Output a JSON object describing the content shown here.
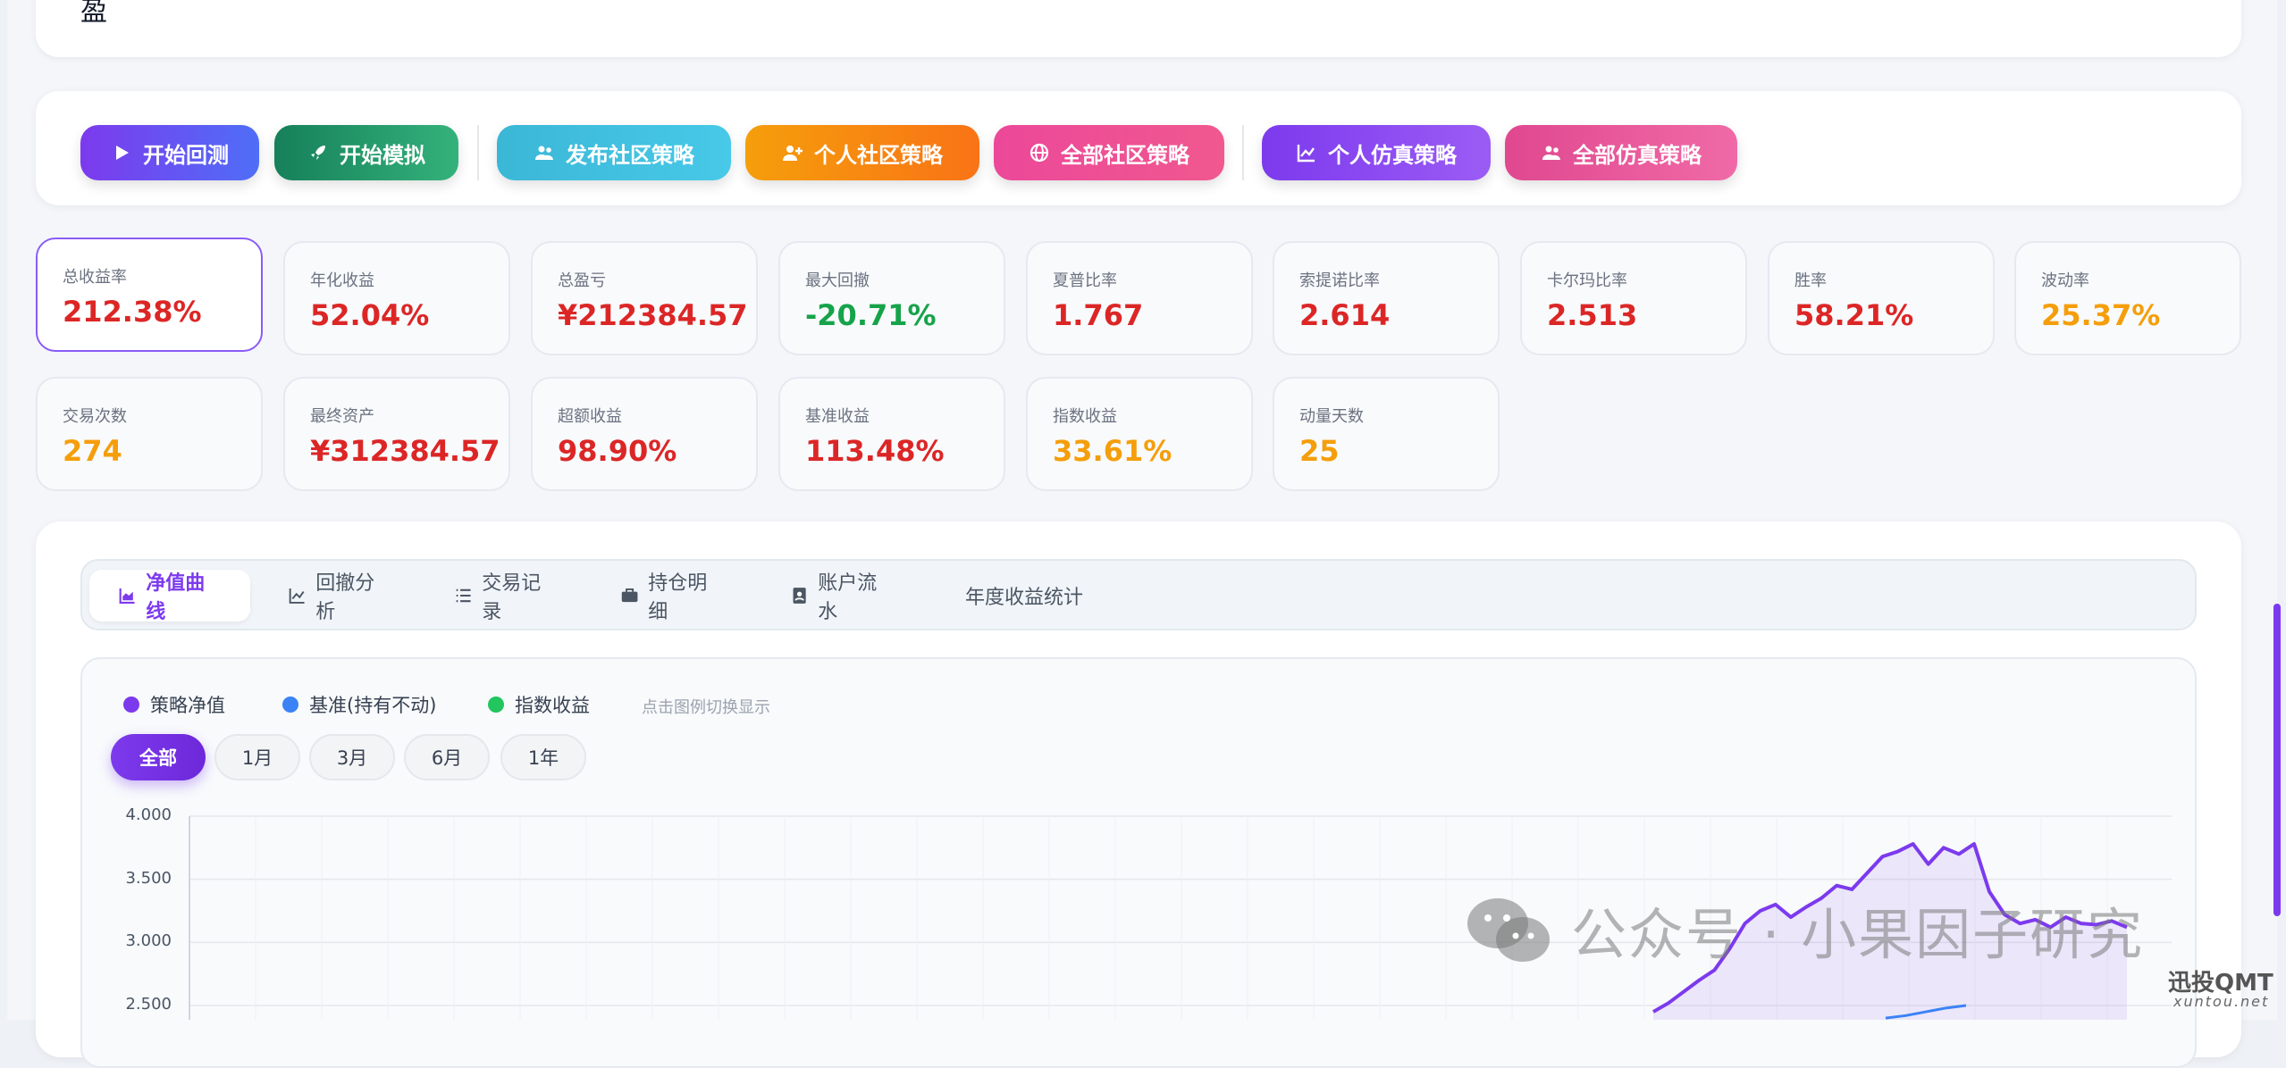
{
  "header_fragment": "盈",
  "toolbar": {
    "buttons": [
      {
        "label": "开始回测",
        "icon": "play-icon"
      },
      {
        "label": "开始模拟",
        "icon": "rocket-icon"
      },
      {
        "label": "发布社区策略",
        "icon": "users-icon"
      },
      {
        "label": "个人社区策略",
        "icon": "user-plus-icon"
      },
      {
        "label": "全部社区策略",
        "icon": "globe-icon"
      },
      {
        "label": "个人仿真策略",
        "icon": "line-chart-icon"
      },
      {
        "label": "全部仿真策略",
        "icon": "users-icon"
      }
    ]
  },
  "stats": [
    {
      "label": "总收益率",
      "value": "212.38%"
    },
    {
      "label": "年化收益",
      "value": "52.04%"
    },
    {
      "label": "总盈亏",
      "value": "¥212384.57"
    },
    {
      "label": "最大回撤",
      "value": "-20.71%"
    },
    {
      "label": "夏普比率",
      "value": "1.767"
    },
    {
      "label": "索提诺比率",
      "value": "2.614"
    },
    {
      "label": "卡尔玛比率",
      "value": "2.513"
    },
    {
      "label": "胜率",
      "value": "58.21%"
    },
    {
      "label": "波动率",
      "value": "25.37%"
    },
    {
      "label": "交易次数",
      "value": "274"
    },
    {
      "label": "最终资产",
      "value": "¥312384.57"
    },
    {
      "label": "超额收益",
      "value": "98.90%"
    },
    {
      "label": "基准收益",
      "value": "113.48%"
    },
    {
      "label": "指数收益",
      "value": "33.61%"
    },
    {
      "label": "动量天数",
      "value": "25"
    }
  ],
  "tabs": [
    {
      "label": "净值曲线",
      "icon": "area-chart-icon"
    },
    {
      "label": "回撤分析",
      "icon": "line-chart-icon"
    },
    {
      "label": "交易记录",
      "icon": "list-icon"
    },
    {
      "label": "持仓明细",
      "icon": "briefcase-icon"
    },
    {
      "label": "账户流水",
      "icon": "ledger-icon"
    },
    {
      "label": "年度收益统计",
      "icon": ""
    }
  ],
  "legend": {
    "items": [
      {
        "label": "策略净值",
        "color": "#7c3aed"
      },
      {
        "label": "基准(持有不动)",
        "color": "#3b82f6"
      },
      {
        "label": "指数收益",
        "color": "#22c55e"
      }
    ],
    "hint": "点击图例切换显示"
  },
  "ranges": [
    "全部",
    "1月",
    "3月",
    "6月",
    "1年"
  ],
  "chart_data": {
    "type": "line",
    "yticks": [
      "4.000",
      "3.500",
      "3.000",
      "2.500"
    ],
    "ylim": [
      2.5,
      4.0
    ],
    "series": [
      {
        "name": "策略净值",
        "color": "#7c3aed",
        "values": [
          2.45,
          2.52,
          2.61,
          2.7,
          2.78,
          2.95,
          3.15,
          3.25,
          3.3,
          3.2,
          3.28,
          3.35,
          3.45,
          3.42,
          3.55,
          3.68,
          3.72,
          3.78,
          3.62,
          3.75,
          3.7,
          3.78,
          3.4,
          3.22,
          3.15,
          3.18,
          3.12,
          3.2,
          3.15,
          3.14,
          3.17,
          3.12
        ]
      },
      {
        "name": "基准(持有不动)",
        "color": "#3b82f6",
        "values": [
          2.4,
          2.42,
          2.45,
          2.48,
          2.5
        ]
      }
    ]
  },
  "watermark": {
    "text": "公众号 · 小果因子研究",
    "site": "迅投QMT",
    "site_url": "xuntou.net"
  }
}
